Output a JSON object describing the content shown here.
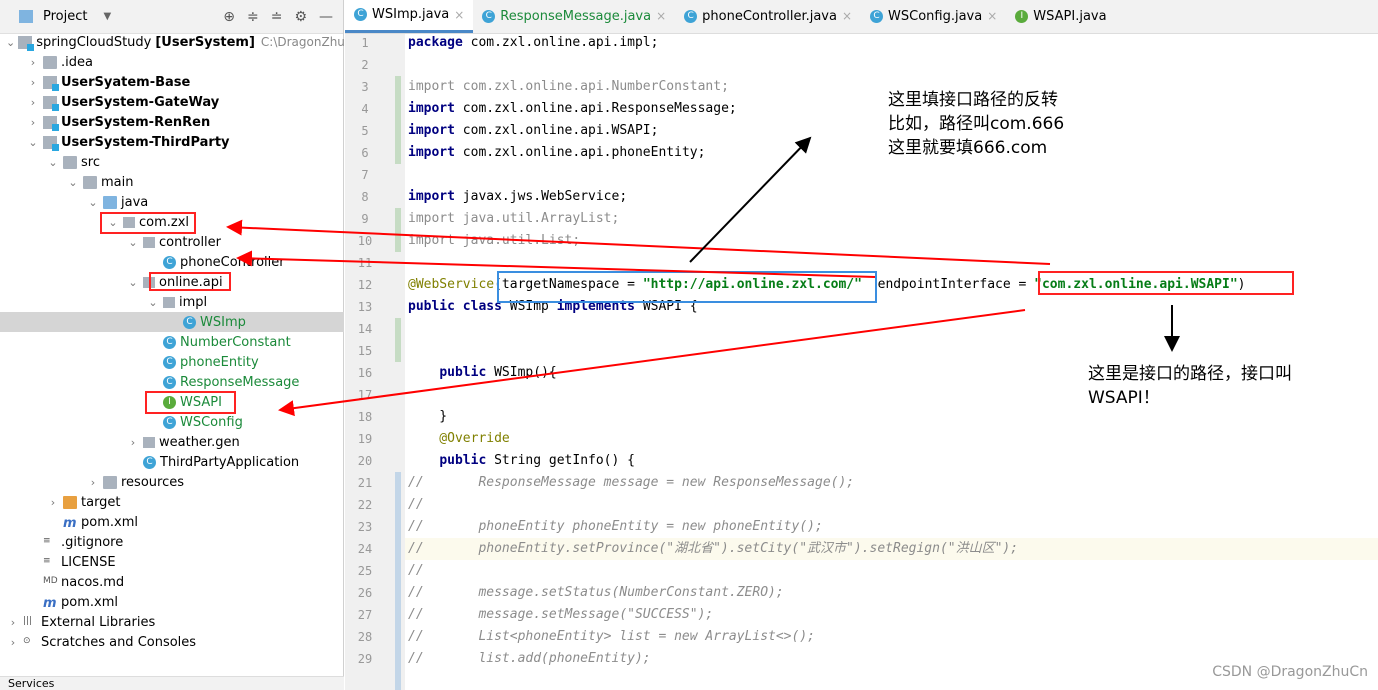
{
  "sidebar": {
    "title": "Project",
    "tree": [
      {
        "label": "springCloudStudy",
        "extra": "[UserSystem]",
        "path": "C:\\DragonZhu\\spr",
        "lvl": 0,
        "icon": "module",
        "open": true
      },
      {
        "label": ".idea",
        "lvl": 1,
        "icon": "folder",
        "open": false
      },
      {
        "label": "UserSyatem-Base",
        "lvl": 1,
        "icon": "module",
        "open": false,
        "bold": true
      },
      {
        "label": "UserSystem-GateWay",
        "lvl": 1,
        "icon": "module",
        "open": false,
        "bold": true
      },
      {
        "label": "UserSystem-RenRen",
        "lvl": 1,
        "icon": "module",
        "open": false,
        "bold": true
      },
      {
        "label": "UserSystem-ThirdParty",
        "lvl": 1,
        "icon": "module",
        "open": true,
        "bold": true
      },
      {
        "label": "src",
        "lvl": 2,
        "icon": "folder",
        "open": true
      },
      {
        "label": "main",
        "lvl": 3,
        "icon": "folder",
        "open": true
      },
      {
        "label": "java",
        "lvl": 4,
        "icon": "folder-blue",
        "open": true
      },
      {
        "label": "com.zxl",
        "lvl": 5,
        "icon": "package",
        "open": true
      },
      {
        "label": "controller",
        "lvl": 6,
        "icon": "package",
        "open": true
      },
      {
        "label": "phoneController",
        "lvl": 7,
        "icon": "class"
      },
      {
        "label": "online.api",
        "lvl": 6,
        "icon": "package",
        "open": true
      },
      {
        "label": "impl",
        "lvl": 7,
        "icon": "package",
        "open": true
      },
      {
        "label": "WSImp",
        "lvl": 8,
        "icon": "class",
        "green": true,
        "selected": true
      },
      {
        "label": "NumberConstant",
        "lvl": 7,
        "icon": "class",
        "green": true
      },
      {
        "label": "phoneEntity",
        "lvl": 7,
        "icon": "class",
        "green": true
      },
      {
        "label": "ResponseMessage",
        "lvl": 7,
        "icon": "class",
        "green": true
      },
      {
        "label": "WSAPI",
        "lvl": 7,
        "icon": "interface",
        "green": true
      },
      {
        "label": "WSConfig",
        "lvl": 7,
        "icon": "class",
        "green": true
      },
      {
        "label": "weather.gen",
        "lvl": 6,
        "icon": "package",
        "open": false
      },
      {
        "label": "ThirdPartyApplication",
        "lvl": 6,
        "icon": "class"
      },
      {
        "label": "resources",
        "lvl": 4,
        "icon": "folder",
        "open": false
      },
      {
        "label": "target",
        "lvl": 2,
        "icon": "folder-orange",
        "open": false
      },
      {
        "label": "pom.xml",
        "lvl": 2,
        "icon": "maven"
      },
      {
        "label": ".gitignore",
        "lvl": 1,
        "icon": "file"
      },
      {
        "label": "LICENSE",
        "lvl": 1,
        "icon": "file"
      },
      {
        "label": "nacos.md",
        "lvl": 1,
        "icon": "markdown"
      },
      {
        "label": "pom.xml",
        "lvl": 1,
        "icon": "maven"
      },
      {
        "label": "External Libraries",
        "lvl": 0,
        "icon": "library",
        "open": false
      },
      {
        "label": "Scratches and Consoles",
        "lvl": 0,
        "icon": "scratch",
        "open": false
      }
    ],
    "status": "Services"
  },
  "tabs": [
    {
      "label": "WSImp.java",
      "active": true,
      "icon": "class"
    },
    {
      "label": "ResponseMessage.java",
      "green": true,
      "icon": "class"
    },
    {
      "label": "phoneController.java",
      "icon": "class"
    },
    {
      "label": "WSConfig.java",
      "icon": "class"
    },
    {
      "label": "WSAPI.java",
      "icon": "interface"
    }
  ],
  "code": [
    [
      [
        "kw",
        "package "
      ],
      [
        "",
        "com.zxl.online.api.impl;"
      ]
    ],
    [],
    [
      [
        "gi",
        "import com.zxl.online.api.NumberConstant;"
      ]
    ],
    [
      [
        "kw",
        "import "
      ],
      [
        "",
        "com.zxl.online.api.ResponseMessage;"
      ]
    ],
    [
      [
        "kw",
        "import "
      ],
      [
        "",
        "com.zxl.online.api.WSAPI;"
      ]
    ],
    [
      [
        "kw",
        "import "
      ],
      [
        "",
        "com.zxl.online.api.phoneEntity;"
      ]
    ],
    [],
    [
      [
        "kw",
        "import "
      ],
      [
        "",
        "javax.jws.WebService;"
      ]
    ],
    [
      [
        "gi",
        "import java.util.ArrayList;"
      ]
    ],
    [
      [
        "gi",
        "import java.util.List;"
      ]
    ],
    [],
    [
      [
        "ann",
        "@WebService"
      ],
      [
        "",
        "(targetNamespace = "
      ],
      [
        "str",
        "\"http://api.online.zxl.com/\""
      ],
      [
        "",
        "  endpointInterface = "
      ],
      [
        "str",
        "\"com.zxl.online.api.WSAPI\""
      ],
      [
        "",
        ")"
      ]
    ],
    [
      [
        "kw",
        "public class "
      ],
      [
        "",
        "WSImp "
      ],
      [
        "kw",
        "implements "
      ],
      [
        "",
        "WSAPI {"
      ]
    ],
    [],
    [],
    [
      [
        "",
        "    "
      ],
      [
        "kw",
        "public "
      ],
      [
        "",
        "WSImp(){"
      ]
    ],
    [],
    [
      [
        "",
        "    }"
      ]
    ],
    [
      [
        "ann",
        "    @Override"
      ]
    ],
    [
      [
        "",
        "    "
      ],
      [
        "kw",
        "public "
      ],
      [
        "",
        "String getInfo() {"
      ]
    ],
    [
      [
        "cm",
        "//       ResponseMessage message = new ResponseMessage();"
      ]
    ],
    [
      [
        "cm",
        "//"
      ]
    ],
    [
      [
        "cm",
        "//       phoneEntity phoneEntity = new phoneEntity();"
      ]
    ],
    [
      [
        "cm",
        "//       phoneEntity.setProvince(\"湖北省\").setCity(\"武汉市\").setRegign(\"洪山区\");"
      ]
    ],
    [
      [
        "cm",
        "//"
      ]
    ],
    [
      [
        "cm",
        "//       message.setStatus(NumberConstant.ZERO);"
      ]
    ],
    [
      [
        "cm",
        "//       message.setMessage(\"SUCCESS\");"
      ]
    ],
    [
      [
        "cm",
        "//       List<phoneEntity> list = new ArrayList<>();"
      ]
    ],
    [
      [
        "cm",
        "//       list.add(phoneEntity);"
      ]
    ]
  ],
  "annotations": {
    "note1": [
      "这里填接口路径的反转",
      "比如，路径叫com.666",
      "这里就要填666.com"
    ],
    "note2": [
      "这里是接口的路径，接口叫",
      "WSAPI！"
    ],
    "arrow_color": "#ff0000"
  },
  "watermark": "CSDN @DragonZhuCn"
}
